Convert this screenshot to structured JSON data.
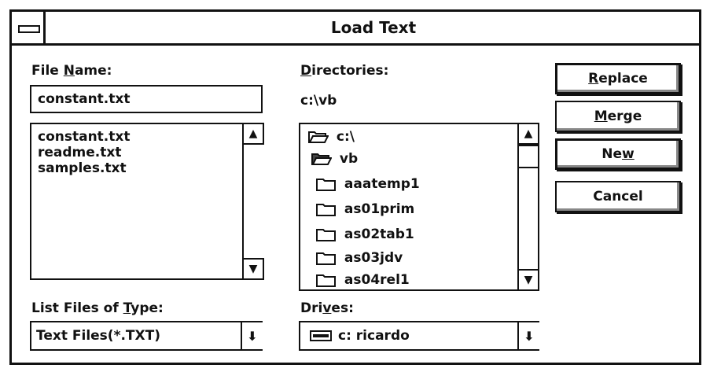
{
  "window": {
    "title": "Load Text"
  },
  "file_name": {
    "label_pre": "File ",
    "label_u": "N",
    "label_post": "ame:",
    "value": "constant.txt",
    "files": [
      "constant.txt",
      "readme.txt",
      "samples.txt"
    ]
  },
  "directories": {
    "label_u": "D",
    "label_post": "irectories:",
    "current_path": "c:\\vb",
    "items": [
      {
        "name": "c:\\",
        "icon": "open-folder-icon"
      },
      {
        "name": "vb",
        "icon": "open-folder-filled-icon"
      },
      {
        "name": "aaatemp1",
        "icon": "folder-icon"
      },
      {
        "name": "as01prim",
        "icon": "folder-icon"
      },
      {
        "name": "as02tab1",
        "icon": "folder-icon"
      },
      {
        "name": "as03jdv",
        "icon": "folder-icon"
      },
      {
        "name": "as04rel1",
        "icon": "folder-icon"
      }
    ]
  },
  "buttons": {
    "replace_u": "R",
    "replace_post": "eplace",
    "merge_u": "M",
    "merge_post": "erge",
    "new_pre": "Ne",
    "new_u": "w",
    "cancel": "Cancel"
  },
  "file_type": {
    "label_pre": "List Files of ",
    "label_u": "T",
    "label_post": "ype:",
    "value": "Text Files(*.TXT)"
  },
  "drives": {
    "label_pre": "Dri",
    "label_u": "v",
    "label_post": "es:",
    "value": "c: ricardo",
    "icon": "drive-icon"
  },
  "icons": {
    "scroll_up": "▲",
    "scroll_down": "▼",
    "dropdown": "⬇"
  }
}
